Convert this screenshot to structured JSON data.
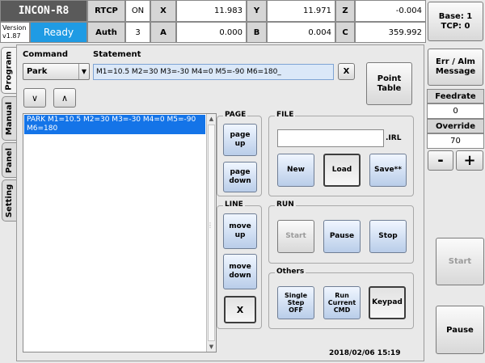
{
  "header": {
    "app_title": "INCON-R8",
    "version_label": "Version",
    "version_value": "v1.87",
    "status": "Ready",
    "rtcp_label": "RTCP",
    "rtcp_value": "ON",
    "auth_label": "Auth",
    "auth_value": "3",
    "coords": {
      "x_label": "X",
      "x_value": "11.983",
      "y_label": "Y",
      "y_value": "11.971",
      "z_label": "Z",
      "z_value": "-0.004",
      "a_label": "A",
      "a_value": "0.000",
      "b_label": "B",
      "b_value": "0.004",
      "c_label": "C",
      "c_value": "359.992"
    },
    "base_line1": "Base: 1",
    "base_line2": "TCP: 0"
  },
  "tabs": [
    "Program",
    "Manual",
    "Panel",
    "Setting"
  ],
  "command": {
    "command_label": "Command",
    "statement_label": "Statement",
    "selected_command": "Park",
    "statement_value": "M1=10.5 M2=30 M3=-30 M4=0 M5=-90 M6=180_",
    "clear_label": "X",
    "point_table_line1": "Point",
    "point_table_line2": "Table",
    "down_label": "∨",
    "up_label": "∧"
  },
  "program_list": {
    "items": [
      "PARK M1=10.5 M2=30 M3=-30 M4=0 M5=-90 M6=180"
    ]
  },
  "page_group": {
    "title": "PAGE",
    "page_up": "page\nup",
    "page_down": "page\ndown"
  },
  "line_group": {
    "title": "LINE",
    "move_up": "move\nup",
    "move_down": "move\ndown",
    "delete": "X"
  },
  "file_group": {
    "title": "FILE",
    "filename": "",
    "extension": ".IRL",
    "new": "New",
    "load": "Load",
    "save": "Save**"
  },
  "run_group": {
    "title": "RUN",
    "start": "Start",
    "pause": "Pause",
    "stop": "Stop"
  },
  "others_group": {
    "title": "Others",
    "single_step": "Single\nStep\nOFF",
    "run_current": "Run\nCurrent\nCMD",
    "keypad": "Keypad"
  },
  "datetime": "2018/02/06 15:19",
  "right_panel": {
    "err_alm_line1": "Err / Alm",
    "err_alm_line2": "Message",
    "feedrate_label": "Feedrate",
    "feedrate_value": "0",
    "override_label": "Override",
    "override_value": "70",
    "minus": "-",
    "plus": "+",
    "start": "Start",
    "pause": "Pause"
  },
  "colors": {
    "ready": "#1f9be4",
    "selection": "#1474e8",
    "statement_bg": "#dbe8f8"
  }
}
